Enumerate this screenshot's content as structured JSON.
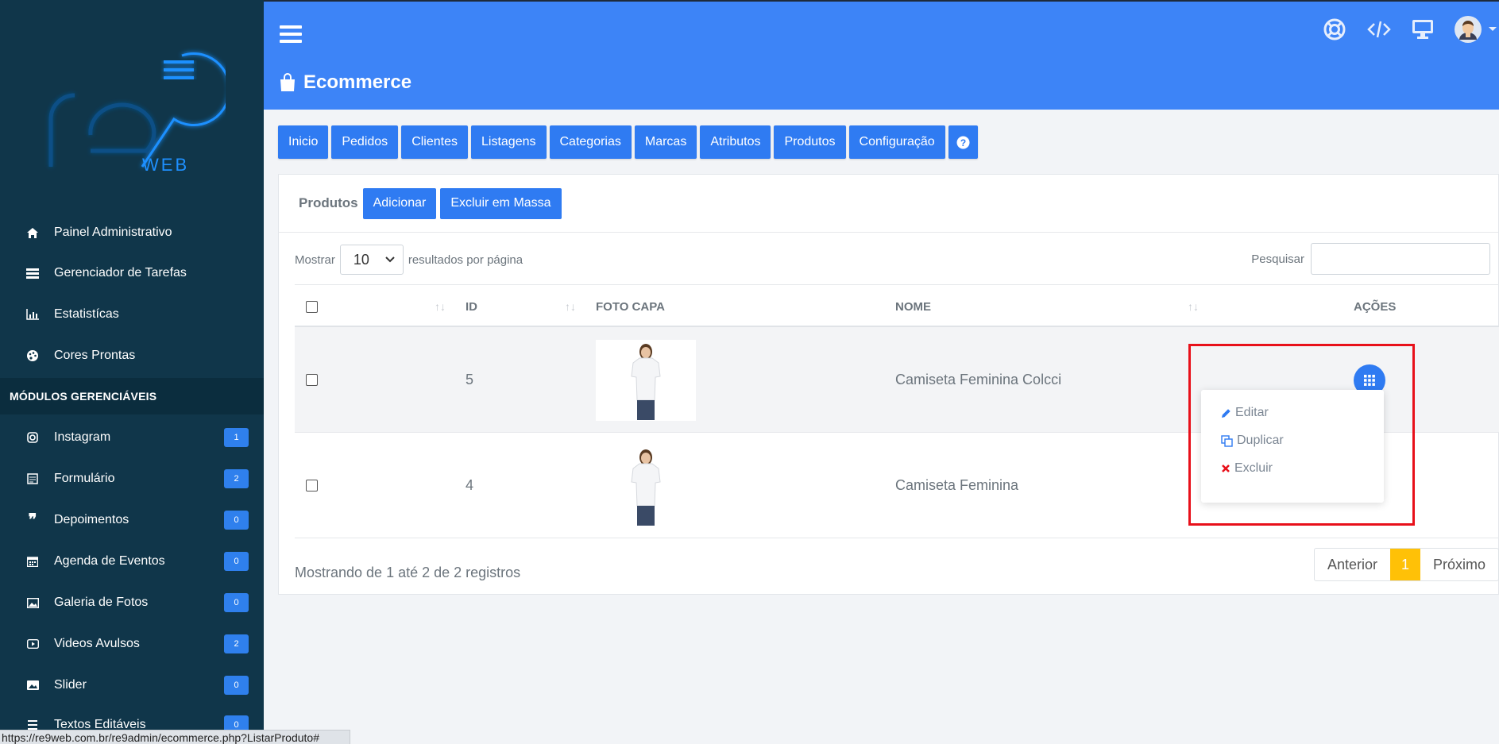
{
  "sidebar": {
    "logo_text": "re9 WEB",
    "items": [
      {
        "label": "Painel Administrativo",
        "icon": "home-icon"
      },
      {
        "label": "Gerenciador de Tarefas",
        "icon": "tasks-icon"
      },
      {
        "label": "Estatistícas",
        "icon": "stats-icon"
      },
      {
        "label": "Cores Prontas",
        "icon": "palette-icon"
      }
    ],
    "section_title": "MÓDULOS GERENCIÁVEIS",
    "modules": [
      {
        "label": "Instagram",
        "badge": "1",
        "icon": "instagram-icon"
      },
      {
        "label": "Formulário",
        "badge": "2",
        "icon": "form-icon"
      },
      {
        "label": "Depoimentos",
        "badge": "0",
        "icon": "quote-icon"
      },
      {
        "label": "Agenda de Eventos",
        "badge": "0",
        "icon": "calendar-icon"
      },
      {
        "label": "Galeria de Fotos",
        "badge": "0",
        "icon": "image-icon"
      },
      {
        "label": "Videos Avulsos",
        "badge": "2",
        "icon": "video-icon"
      },
      {
        "label": "Slider",
        "badge": "0",
        "icon": "slider-icon"
      },
      {
        "label": "Textos Editáveis",
        "badge": "0",
        "icon": "text-icon"
      }
    ]
  },
  "header": {
    "title": "Ecommerce"
  },
  "tabs": [
    "Inicio",
    "Pedidos",
    "Clientes",
    "Listagens",
    "Categorias",
    "Marcas",
    "Atributos",
    "Produtos",
    "Configuração"
  ],
  "panel": {
    "title": "Produtos",
    "add_label": "Adicionar",
    "bulk_delete_label": "Excluir em Massa",
    "show_label": "Mostrar",
    "per_page_value": "10",
    "per_page_suffix": "resultados por página",
    "search_label": "Pesquisar",
    "columns": [
      "ID",
      "FOTO CAPA",
      "NOME",
      "AÇÕES"
    ],
    "rows": [
      {
        "id": "5",
        "name": "Camiseta Feminina Colcci"
      },
      {
        "id": "4",
        "name": "Camiseta Feminina"
      }
    ],
    "footer_info": "Mostrando de 1 até 2 de 2 registros",
    "pagination": {
      "prev": "Anterior",
      "current": "1",
      "next": "Próximo"
    }
  },
  "dropdown": {
    "edit": "Editar",
    "duplicate": "Duplicar",
    "delete": "Excluir"
  },
  "status_url": "https://re9web.com.br/re9admin/ecommerce.php?ListarProduto#",
  "colors": {
    "sidebar_bg": "#10364a",
    "primary": "#2f7bf2",
    "header_bg": "#3d84f7",
    "active_page": "#ffc107",
    "highlight": "#e8101a"
  }
}
